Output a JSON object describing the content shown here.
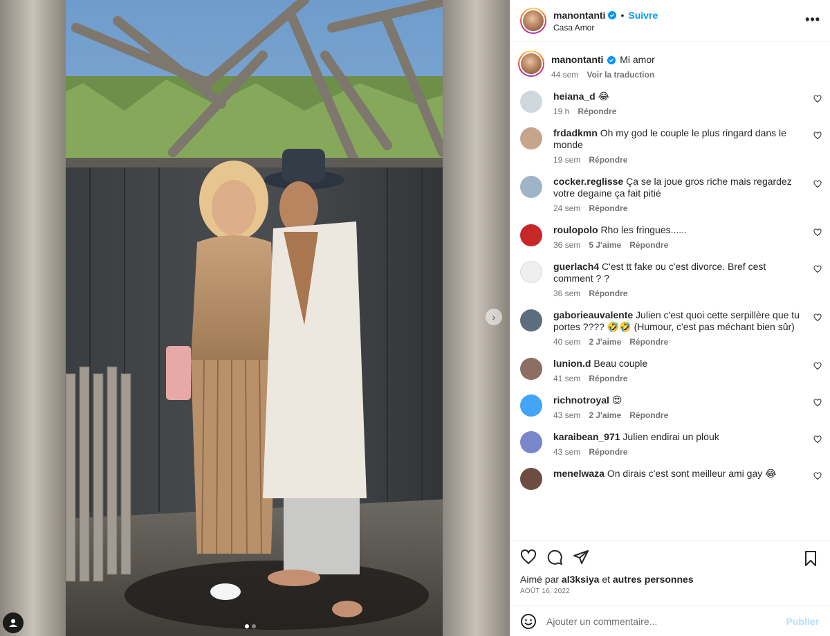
{
  "header": {
    "username": "manontanti",
    "separator": "•",
    "follow_label": "Suivre",
    "location": "Casa Amor",
    "more_icon": "more-horizontal-icon"
  },
  "caption": {
    "username": "manontanti",
    "text": "Mi amor",
    "time": "44 sem",
    "translate_label": "Voir la traduction"
  },
  "comments": [
    {
      "username": "heiana_d",
      "text": "😂",
      "time": "19 h",
      "likes": "",
      "reply": "Répondre",
      "avatar_color": "#cfd8dc"
    },
    {
      "username": "frdadkmn",
      "text": "Oh my god le couple le plus ringard dans le monde",
      "time": "19 sem",
      "likes": "",
      "reply": "Répondre",
      "avatar_color": "#c7a58d"
    },
    {
      "username": "cocker.reglisse",
      "text": "Ça se la joue gros riche mais regardez votre degaine ça fait pitié",
      "time": "24 sem",
      "likes": "",
      "reply": "Répondre",
      "avatar_color": "#9fb4c7"
    },
    {
      "username": "roulopolo",
      "text": "Rho les fringues......",
      "time": "36 sem",
      "likes": "5 J'aime",
      "reply": "Répondre",
      "avatar_color": "#c62828"
    },
    {
      "username": "guerlach4",
      "text": "C'est tt fake ou c'est divorce. Bref cest comment ? ?",
      "time": "36 sem",
      "likes": "",
      "reply": "Répondre",
      "avatar_color": "#dbdbdb"
    },
    {
      "username": "gaborieauvalente",
      "text": "Julien c'est quoi cette serpillère que tu portes ???? 🤣🤣 (Humour, c'est pas méchant bien sûr)",
      "time": "40 sem",
      "likes": "2 J'aime",
      "reply": "Répondre",
      "avatar_color": "#5d6d7e"
    },
    {
      "username": "lunion.d",
      "text": "Beau couple",
      "time": "41 sem",
      "likes": "",
      "reply": "Répondre",
      "avatar_color": "#8d6e63"
    },
    {
      "username": "richnotroyal",
      "text": "😍",
      "time": "43 sem",
      "likes": "2 J'aime",
      "reply": "Répondre",
      "avatar_color": "#42a5f5"
    },
    {
      "username": "karaibean_971",
      "text": "Julien endirai un plouk",
      "time": "43 sem",
      "likes": "",
      "reply": "Répondre",
      "avatar_color": "#7986cb"
    },
    {
      "username": "menelwaza",
      "text": "On dirais c'est sont meilleur ami gay 😂",
      "time": "",
      "likes": "",
      "reply": "",
      "avatar_color": "#6d4c41"
    }
  ],
  "actions": {
    "like_icon": "heart-icon",
    "comment_icon": "comment-icon",
    "share_icon": "share-icon",
    "save_icon": "bookmark-icon"
  },
  "likes": {
    "prefix": "Aimé par",
    "user": "al3ksiya",
    "conj": "et",
    "others": "autres personnes"
  },
  "post_date": "AOÛT 16, 2022",
  "composer": {
    "placeholder": "Ajouter un commentaire...",
    "publish_label": "Publier",
    "emoji_icon": "emoji-icon"
  },
  "carousel": {
    "total": 2,
    "current": 1,
    "next_icon": "chevron-right-icon"
  },
  "colors": {
    "accent": "#0095f6",
    "text": "#262626",
    "muted": "#737373",
    "border": "#efefef",
    "publish_disabled": "#b2dffc"
  }
}
